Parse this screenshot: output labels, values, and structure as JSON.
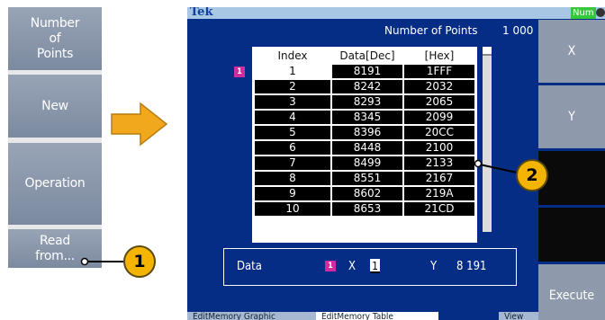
{
  "left_menu": {
    "buttons": [
      {
        "label": "Number\nof\nPoints"
      },
      {
        "label": "New"
      },
      {
        "label": "Operation"
      },
      {
        "label": "Read\nfrom..."
      }
    ]
  },
  "screen": {
    "brand": "Tek",
    "num_badge": "Num",
    "number_of_points_label": "Number of Points",
    "number_of_points_value": "1 000",
    "table": {
      "headers": [
        "Index",
        "Data[Dec]",
        "[Hex]"
      ],
      "rows": [
        [
          "1",
          "8191",
          "1FFF"
        ],
        [
          "2",
          "8242",
          "2032"
        ],
        [
          "3",
          "8293",
          "2065"
        ],
        [
          "4",
          "8345",
          "2099"
        ],
        [
          "5",
          "8396",
          "20CC"
        ],
        [
          "6",
          "8448",
          "2100"
        ],
        [
          "7",
          "8499",
          "2133"
        ],
        [
          "8",
          "8551",
          "2167"
        ],
        [
          "9",
          "8602",
          "219A"
        ],
        [
          "10",
          "8653",
          "21CD"
        ]
      ]
    },
    "marker_label": "1",
    "data_panel": {
      "label": "Data",
      "x_label": "X",
      "x_value": "1",
      "y_label": "Y",
      "y_value": "8 191"
    },
    "right_menu": [
      "X",
      "Y",
      "",
      "",
      "Execute"
    ],
    "bottom_tabs": [
      "EditMemory Graphic",
      "EditMemory Table",
      "View"
    ]
  },
  "callouts": [
    "1",
    "2"
  ],
  "colors": {
    "screen_bg": "#062d86",
    "callout": "#f5b400",
    "marker": "#d02ca0",
    "arrow": "#f2a81d"
  }
}
